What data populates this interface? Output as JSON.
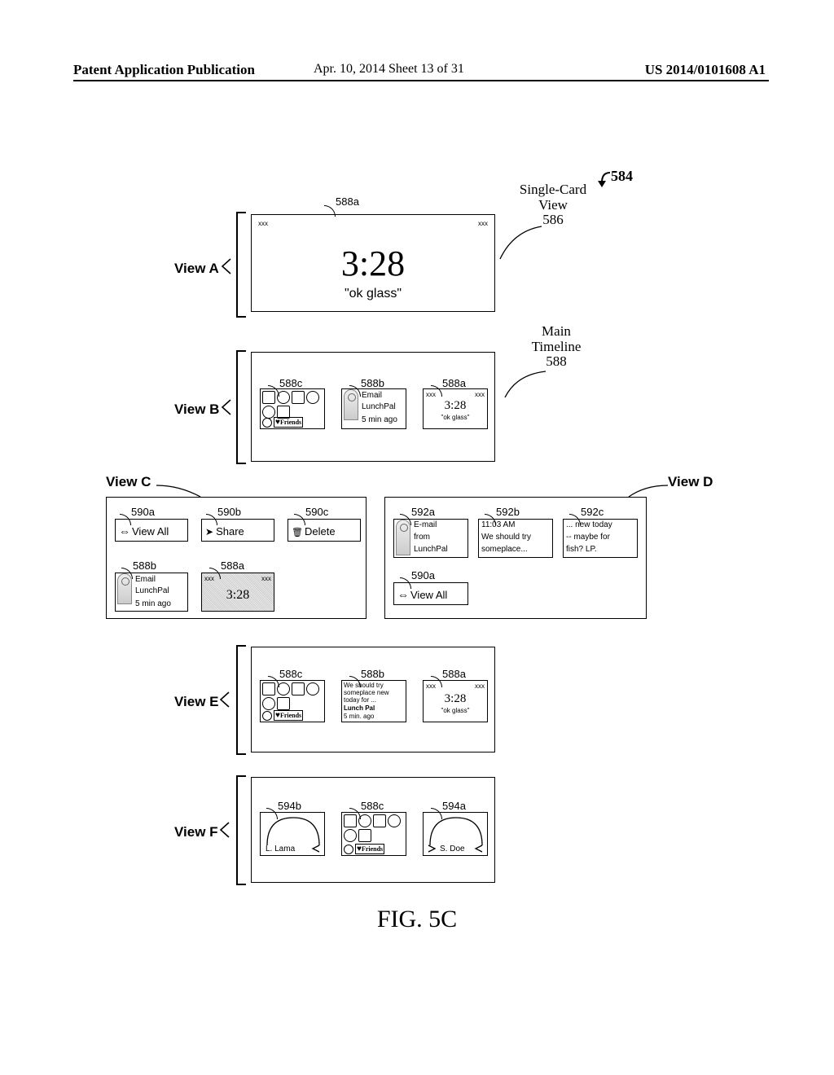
{
  "header": {
    "left": "Patent Application Publication",
    "mid": "Apr. 10, 2014  Sheet 13 of 31",
    "right": "US 2014/0101608 A1"
  },
  "fig": {
    "ref584": "584",
    "singleCardView": "Single-Card View",
    "ref586": "586",
    "mainTimeline": "Main Timeline",
    "ref588": "588",
    "caption": "FIG. 5C"
  },
  "views": {
    "A": "View A",
    "B": "View B",
    "C": "View C",
    "D": "View D",
    "E": "View E",
    "F": "View F"
  },
  "viewA": {
    "ref": "588a",
    "xxxL": "xxx",
    "xxxR": "xxx",
    "clock": "3:28",
    "prompt": "\"ok glass\""
  },
  "viewB": {
    "c588c": {
      "ref": "588c",
      "caption": "Friends",
      "heart": "♥"
    },
    "c588b": {
      "ref": "588b",
      "l1": "Email",
      "l2": "LunchPal",
      "l3": "5 min ago"
    },
    "c588a": {
      "ref": "588a",
      "xxxL": "xxx",
      "xxxR": "xxx",
      "clock": "3:28",
      "prompt": "\"ok glass\""
    }
  },
  "viewC": {
    "c590a": {
      "ref": "590a",
      "label": "View All"
    },
    "c590b": {
      "ref": "590b",
      "label": "Share"
    },
    "c590c": {
      "ref": "590c",
      "label": "Delete"
    },
    "c588b": {
      "ref": "588b",
      "l1": "Email",
      "l2": "LunchPal",
      "l3": "5 min ago"
    },
    "c588a": {
      "ref": "588a",
      "xxxL": "xxx",
      "xxxR": "xxx",
      "clock": "3:28"
    }
  },
  "viewD": {
    "c592a": {
      "ref": "592a",
      "l1": "E-mail",
      "l2": "from",
      "l3": "LunchPal"
    },
    "c592b": {
      "ref": "592b",
      "l1": "11:03 AM",
      "l2": "We should try",
      "l3": "someplace..."
    },
    "c592c": {
      "ref": "592c",
      "l1": "... new today",
      "l2": "-- maybe for",
      "l3": "fish? LP."
    },
    "c590a": {
      "ref": "590a",
      "label": "View All"
    }
  },
  "viewE": {
    "c588c": {
      "ref": "588c",
      "caption": "Friends",
      "heart": "♥"
    },
    "c588b": {
      "ref": "588b",
      "l1": "We should try",
      "l2": "someplace new",
      "l3": "today for ...",
      "l4": "Lunch Pal",
      "l5": "5 min. ago"
    },
    "c588a": {
      "ref": "588a",
      "xxxL": "xxx",
      "xxxR": "xxx",
      "clock": "3:28",
      "prompt": "\"ok glass\""
    }
  },
  "viewF": {
    "c594b": {
      "ref": "594b",
      "label": "L. Lama"
    },
    "c588c": {
      "ref": "588c",
      "caption": "Friends",
      "heart": "♥"
    },
    "c594a": {
      "ref": "594a",
      "label": "S. Doe"
    }
  }
}
